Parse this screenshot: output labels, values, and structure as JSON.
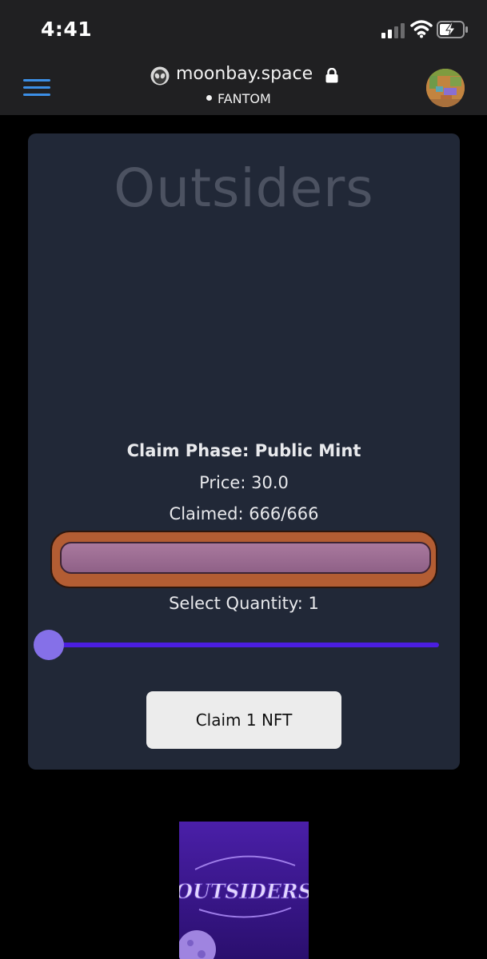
{
  "status_bar": {
    "time": "4:41"
  },
  "browser": {
    "url": "moonbay.space",
    "network": "FANTOM"
  },
  "card": {
    "title": "Outsiders",
    "phase": "Claim Phase: Public Mint",
    "price": "Price: 30.0",
    "claimed": "Claimed: 666/666",
    "progress": 1.0,
    "quantity_label": "Select Quantity: 1",
    "quantity_value": 1,
    "claim_button": "Claim 1 NFT"
  },
  "collection_image": {
    "logo_text": "OUTSIDERS"
  },
  "colors": {
    "card_bg": "#212837",
    "menu_accent": "#3c8fe6",
    "slider_track": "#4b1ee0",
    "slider_thumb": "#8570e8",
    "progress_frame": "#b35d33",
    "progress_fill": "#a9799e"
  },
  "icons": [
    "hamburger-menu-icon",
    "site-favicon-icon",
    "lock-icon",
    "cellular-signal-icon",
    "wifi-icon",
    "battery-charging-icon"
  ]
}
